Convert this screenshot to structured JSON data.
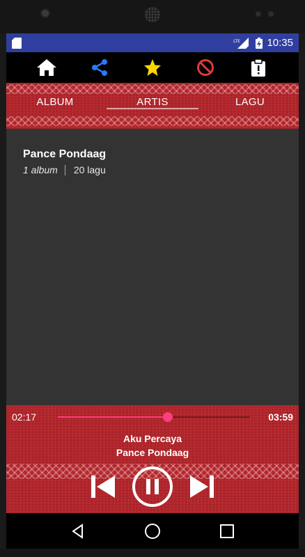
{
  "status_bar": {
    "time": "10:35",
    "network": "LTE"
  },
  "toolbar": {
    "icons": [
      "home-icon",
      "share-icon",
      "star-icon",
      "block-icon",
      "info-clipboard-icon"
    ],
    "colors": {
      "home": "#ffffff",
      "share": "#2979ff",
      "star": "#ffd600",
      "block": "#e53935",
      "info": "#ffffff"
    }
  },
  "tabs": [
    {
      "label": "ALBUM"
    },
    {
      "label": "ARTIS"
    },
    {
      "label": "LAGU"
    }
  ],
  "selected_tab": "ARTIS",
  "artists": [
    {
      "name": "Pance Pondaag",
      "albums": "1 album",
      "songs": "20 lagu"
    }
  ],
  "player": {
    "elapsed": "02:17",
    "duration": "03:59",
    "progress": 0.573,
    "title": "Aku Percaya",
    "artist": "Pance Pondaag",
    "state": "playing",
    "accent": "#ff3d7f"
  },
  "theme": {
    "primary": "#b3262c",
    "status_bar": "#303f9f",
    "background": "#333333"
  }
}
